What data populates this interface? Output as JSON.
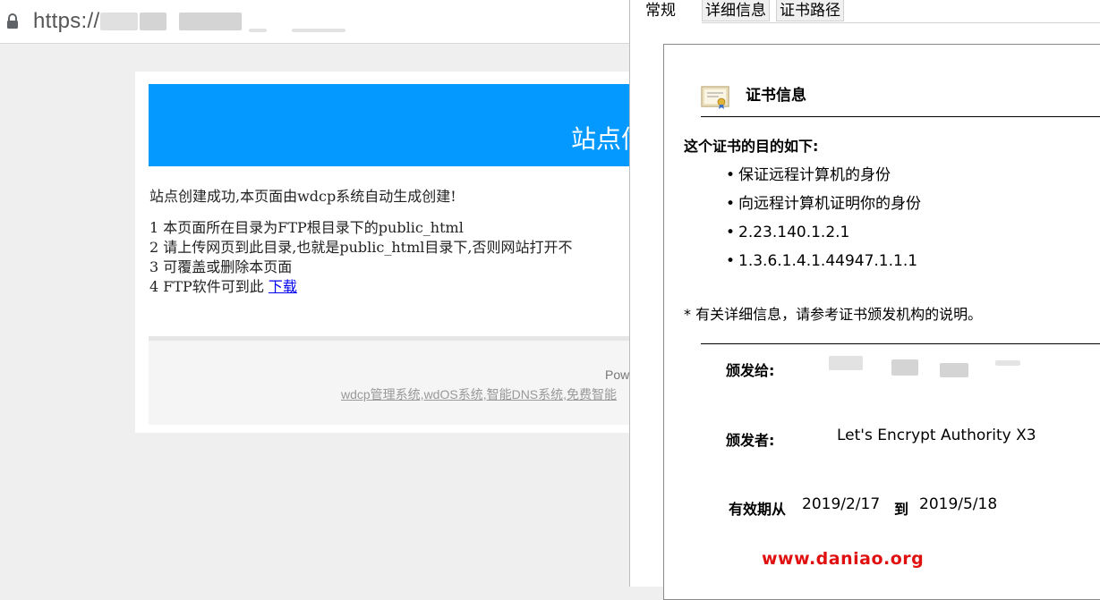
{
  "browser": {
    "url_prefix": "https://",
    "page": {
      "banner_title": "站点信",
      "intro": "站点创建成功,本页面由wdcp系统自动生成创建!",
      "steps": [
        "1 本页面所在目录为FTP根目录下的public_html",
        "2 请上传网页到此目录,也就是public_html目录下,否则网站打开不",
        "3 可覆盖或删除本页面"
      ],
      "step4_prefix": "4 FTP软件可到此 ",
      "step4_link": "下载",
      "powered": "Pow",
      "footer_links": "wdcp管理系统,wdOS系统,智能DNS系统,免费智能"
    }
  },
  "dialog": {
    "tabs": [
      "常规",
      "详细信息",
      "证书路径"
    ],
    "active_tab": 0,
    "cert_title": "证书信息",
    "purpose_title": "这个证书的目的如下:",
    "purposes": [
      "保证远程计算机的身份",
      "向远程计算机证明你的身份",
      "2.23.140.1.2.1",
      "1.3.6.1.4.1.44947.1.1.1"
    ],
    "note": "* 有关详细信息，请参考证书颁发机构的说明。",
    "issued_to_label": "颁发给:",
    "issued_by_label": "颁发者:",
    "issued_by_value": "Let's Encrypt Authority X3",
    "valid_from_label": "有效期从",
    "valid_from": "2019/2/17",
    "valid_to_label": "到",
    "valid_to": "2019/5/18"
  },
  "watermark": "www.daniao.org",
  "colors": {
    "banner_blue": "#0499ff",
    "link_blue": "#0000ee",
    "watermark_red": "#e01010"
  },
  "icons": {
    "lock": "lock-icon",
    "certificate": "certificate-icon"
  }
}
